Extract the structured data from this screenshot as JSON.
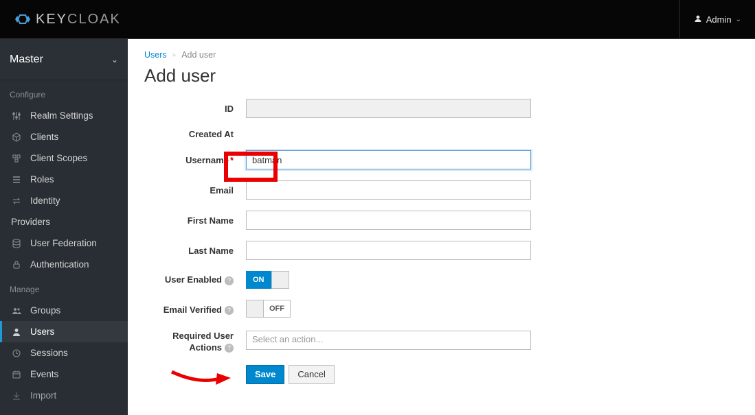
{
  "header": {
    "logo_text_main": "KEY",
    "logo_text_sub": "CLOAK",
    "admin_label": "Admin"
  },
  "sidebar": {
    "realm": "Master",
    "sections": {
      "configure": "Configure",
      "manage": "Manage"
    },
    "items": {
      "realm_settings": "Realm Settings",
      "clients": "Clients",
      "client_scopes": "Client Scopes",
      "roles": "Roles",
      "identity": "Identity",
      "providers": "Providers",
      "user_federation": "User Federation",
      "authentication": "Authentication",
      "groups": "Groups",
      "users": "Users",
      "sessions": "Sessions",
      "events": "Events",
      "import": "Import"
    }
  },
  "breadcrumb": {
    "users": "Users",
    "current": "Add user"
  },
  "page_title": "Add user",
  "form": {
    "id": {
      "label": "ID",
      "value": ""
    },
    "created_at": {
      "label": "Created At"
    },
    "username": {
      "label": "Username",
      "value": "batman"
    },
    "email": {
      "label": "Email",
      "value": ""
    },
    "first_name": {
      "label": "First Name",
      "value": ""
    },
    "last_name": {
      "label": "Last Name",
      "value": ""
    },
    "user_enabled": {
      "label": "User Enabled",
      "state": "ON"
    },
    "email_verified": {
      "label": "Email Verified",
      "state": "OFF"
    },
    "required_actions": {
      "label_line1": "Required User",
      "label_line2": "Actions",
      "placeholder": "Select an action..."
    }
  },
  "buttons": {
    "save": "Save",
    "cancel": "Cancel"
  }
}
